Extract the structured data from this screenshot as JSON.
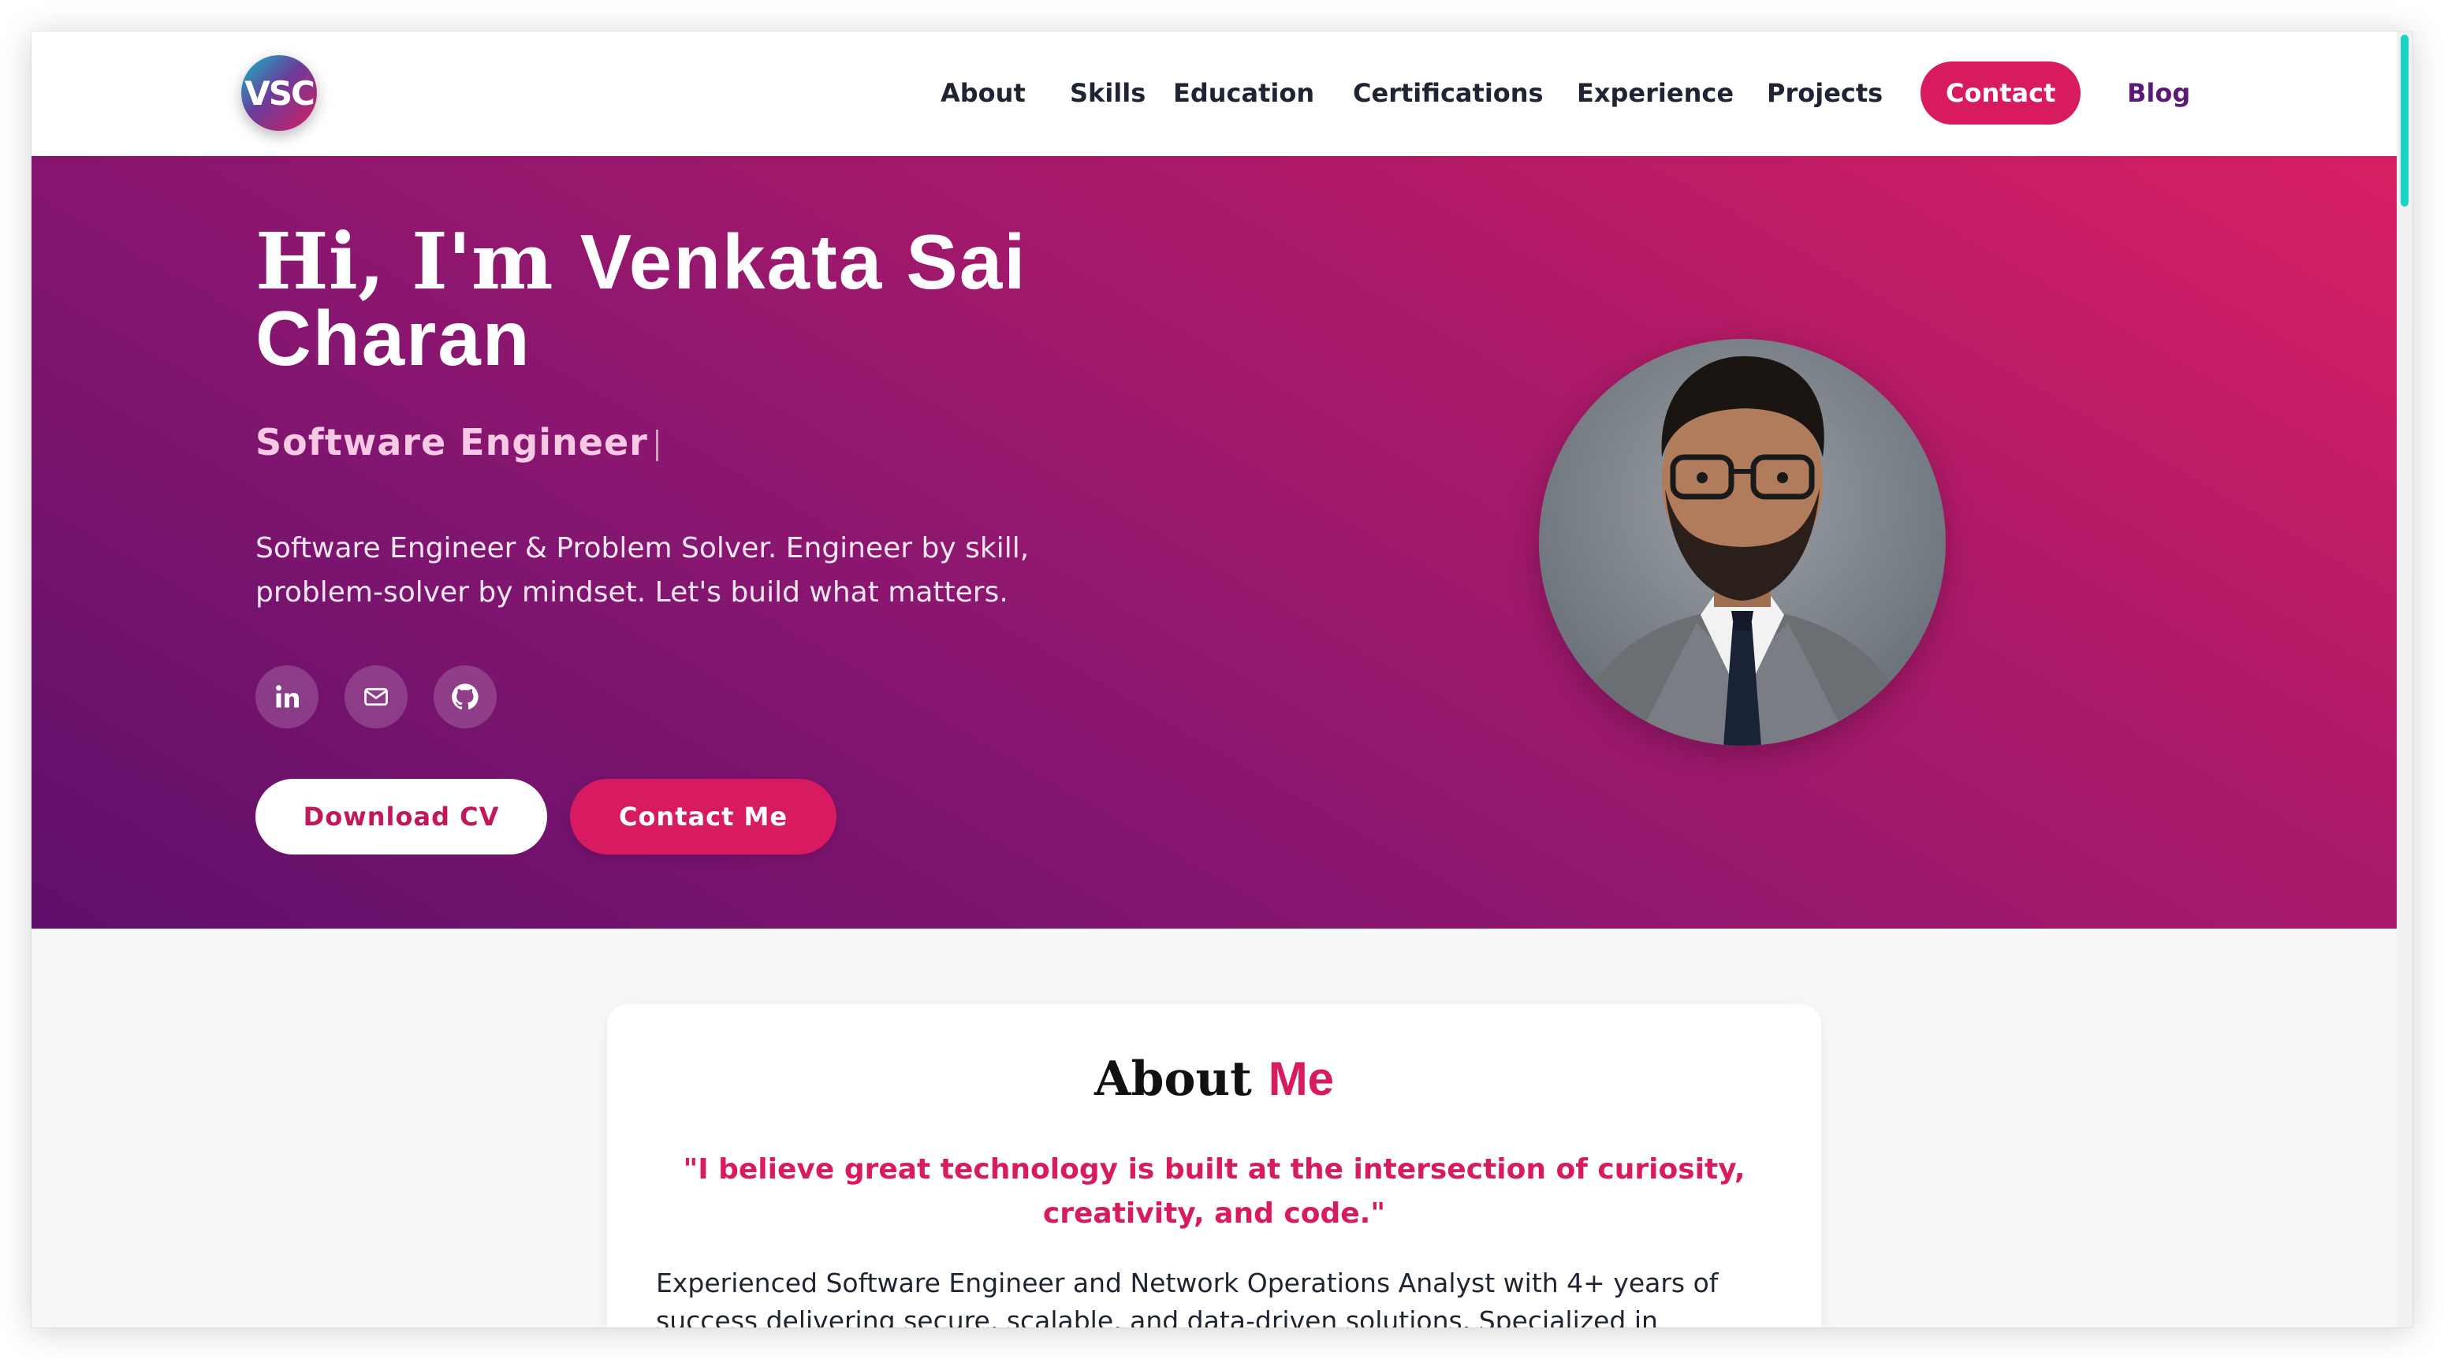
{
  "nav": {
    "logo_text": "VSC",
    "items": [
      {
        "label": "About"
      },
      {
        "label": "Skills"
      },
      {
        "label": "Education"
      },
      {
        "label": "Certifications"
      },
      {
        "label": "Experience"
      },
      {
        "label": "Projects"
      },
      {
        "label": "Contact"
      },
      {
        "label": "Blog"
      }
    ]
  },
  "hero": {
    "greeting": "Hi, I'm",
    "name_line1": "Venkata Sai",
    "name_line2": "Charan",
    "role": "Software Engineer",
    "description": "Software Engineer & Problem Solver. Engineer by skill, problem-solver by mindset. Let's build what matters.",
    "social_icons": [
      "linkedin-icon",
      "mail-icon",
      "github-icon"
    ],
    "download_cv_label": "Download CV",
    "contact_me_label": "Contact Me"
  },
  "about": {
    "title_part1": "About",
    "title_part2": "Me",
    "quote": "\"I believe great technology is built at the intersection of curiosity, creativity, and code.\"",
    "body": "Experienced Software Engineer and Network Operations Analyst with 4+ years of success delivering secure, scalable, and data-driven solutions. Specialized in backend"
  },
  "colors": {
    "accent": "#d81b60",
    "hero_gradient_start": "#5e0f6b",
    "hero_gradient_end": "#d81f63",
    "scroll_thumb": "#19d3c5"
  }
}
